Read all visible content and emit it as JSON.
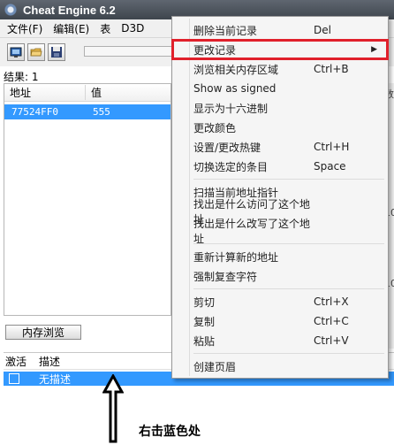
{
  "window": {
    "title": "Cheat Engine 6.2"
  },
  "menubar": {
    "items": [
      "文件(F)",
      "编辑(E)",
      "表",
      "D3D"
    ]
  },
  "toolbar": {
    "buttons": [
      {
        "icon": "process-select-icon"
      },
      {
        "icon": "open-folder-icon"
      },
      {
        "icon": "save-icon"
      }
    ]
  },
  "found": {
    "label": "结果:",
    "count": "1"
  },
  "results": {
    "columns": [
      "地址",
      "值"
    ],
    "rows": [
      {
        "address": "77524FF0",
        "value": "555"
      }
    ]
  },
  "memory_view_button": "内存浏览",
  "cheat_table": {
    "columns": [
      "激活",
      "描述"
    ],
    "rows": [
      {
        "description": "无描述"
      }
    ]
  },
  "right_fragments": [
    "数",
    "10",
    "10"
  ],
  "annotation": {
    "text": "右击蓝色处"
  },
  "context_menu": {
    "groups": [
      [
        {
          "label": "删除当前记录",
          "shortcut": "Del",
          "submenu": false
        },
        {
          "label": "更改记录",
          "shortcut": "",
          "submenu": true,
          "highlighted": true
        },
        {
          "label": "浏览相关内存区域",
          "shortcut": "Ctrl+B",
          "submenu": false
        },
        {
          "label": "Show as signed",
          "shortcut": "",
          "submenu": false
        },
        {
          "label": "显示为十六进制",
          "shortcut": "",
          "submenu": false
        },
        {
          "label": "更改颜色",
          "shortcut": "",
          "submenu": false
        },
        {
          "label": "设置/更改热键",
          "shortcut": "Ctrl+H",
          "submenu": false
        },
        {
          "label": "切换选定的条目",
          "shortcut": "Space",
          "submenu": false
        }
      ],
      [
        {
          "label": "扫描当前地址指针",
          "shortcut": "",
          "submenu": false
        },
        {
          "label": "找出是什么访问了这个地址",
          "shortcut": "",
          "submenu": false
        },
        {
          "label": "找出是什么改写了这个地址",
          "shortcut": "",
          "submenu": false
        }
      ],
      [
        {
          "label": "重新计算新的地址",
          "shortcut": "",
          "submenu": false
        },
        {
          "label": "强制复查字符",
          "shortcut": "",
          "submenu": false
        }
      ],
      [
        {
          "label": "剪切",
          "shortcut": "Ctrl+X",
          "submenu": false
        },
        {
          "label": "复制",
          "shortcut": "Ctrl+C",
          "submenu": false
        },
        {
          "label": "粘贴",
          "shortcut": "Ctrl+V",
          "submenu": false
        }
      ],
      [
        {
          "label": "创建页眉",
          "shortcut": "",
          "submenu": false
        }
      ]
    ]
  },
  "colors": {
    "selection": "#3399ff",
    "highlight_box": "#e0202b"
  }
}
